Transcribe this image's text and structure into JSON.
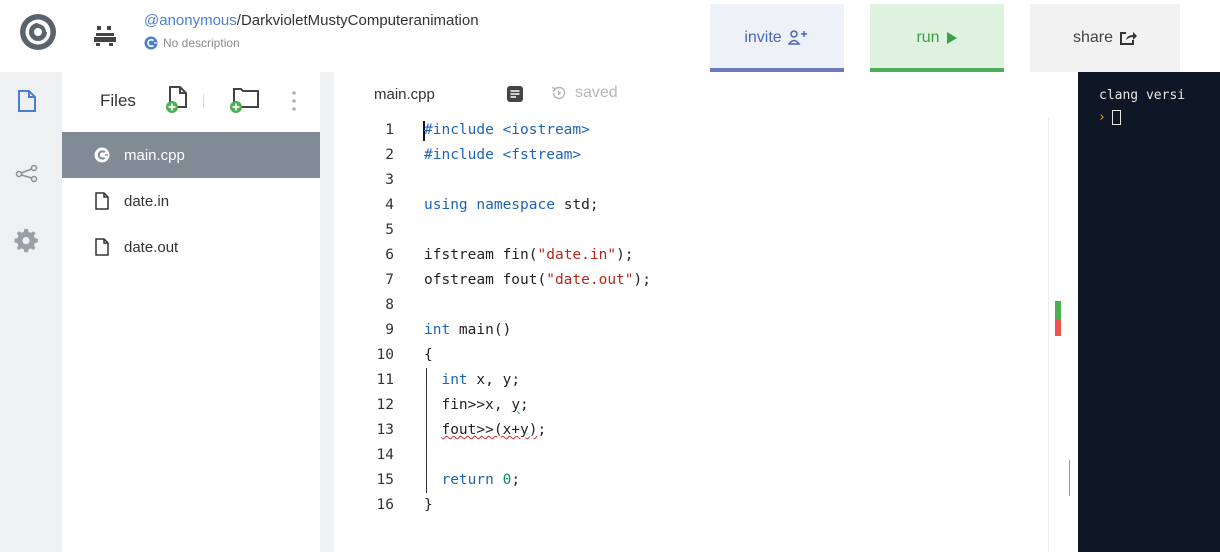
{
  "header": {
    "username": "@anonymous",
    "separator": "/",
    "repl_name": "DarkvioletMustyComputeranimation",
    "description": "No description",
    "invite_label": "invite",
    "run_label": "run",
    "share_label": "share"
  },
  "rail": {
    "icons": [
      "files-icon",
      "share-nodes-icon",
      "settings-gear-icon"
    ]
  },
  "files": {
    "title": "Files",
    "items": [
      {
        "name": "main.cpp",
        "icon": "cpp-file-icon",
        "active": true
      },
      {
        "name": "date.in",
        "icon": "file-icon",
        "active": false
      },
      {
        "name": "date.out",
        "icon": "file-icon",
        "active": false
      }
    ]
  },
  "editor": {
    "tab_name": "main.cpp",
    "saved_label": "saved",
    "lines": [
      {
        "n": "1",
        "text": "#include <iostream>"
      },
      {
        "n": "2",
        "text": "#include <fstream>"
      },
      {
        "n": "3",
        "text": ""
      },
      {
        "n": "4",
        "text": "using namespace std;"
      },
      {
        "n": "5",
        "text": ""
      },
      {
        "n": "6",
        "text": "ifstream fin(\"date.in\");"
      },
      {
        "n": "7",
        "text": "ofstream fout(\"date.out\");"
      },
      {
        "n": "8",
        "text": ""
      },
      {
        "n": "9",
        "text": "int main()"
      },
      {
        "n": "10",
        "text": "{"
      },
      {
        "n": "11",
        "text": "  int x, y;"
      },
      {
        "n": "12",
        "text": "  fin>>x, y;"
      },
      {
        "n": "13",
        "text": "  fout>>(x+y);"
      },
      {
        "n": "14",
        "text": ""
      },
      {
        "n": "15",
        "text": "  return 0;"
      },
      {
        "n": "16",
        "text": "}"
      }
    ]
  },
  "console": {
    "output": "clang versi",
    "prompt": "›"
  },
  "colors": {
    "accent_blue": "#4a7fd1",
    "run_green": "#3aa148",
    "console_bg": "#0f1726",
    "active_file_bg": "#818b96"
  }
}
